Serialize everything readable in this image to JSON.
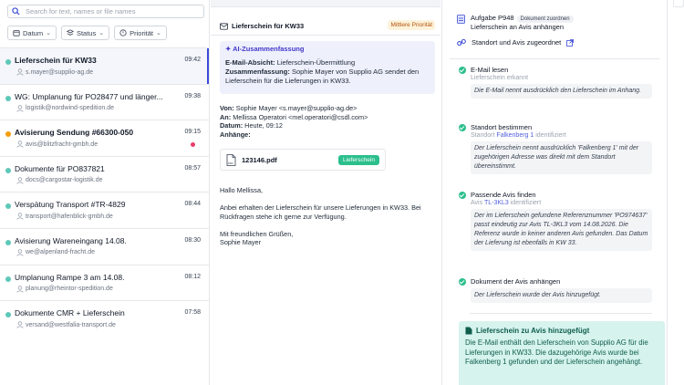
{
  "search": {
    "placeholder": "Search for text, names or file names"
  },
  "filters": [
    {
      "label": "Datum"
    },
    {
      "label": "Status"
    },
    {
      "label": "Priorität"
    }
  ],
  "emails": [
    {
      "title": "Lieferschein für KW33",
      "email": "s.mayer@supplio-ag.de",
      "time": "09:42",
      "bold": true,
      "active": true,
      "dot": "teal"
    },
    {
      "title": "WG: Umplanung für PO28477 und länger...",
      "email": "logistik@nordwind-spedition.de",
      "time": "09:38",
      "dot": "teal"
    },
    {
      "title": "Avisierung Sendung #66300-050",
      "email": "avis@blitzfracht-gmbh.de",
      "time": "09:15",
      "bold": true,
      "dot": "orange",
      "unread": true
    },
    {
      "title": "Dokumente für PO837821",
      "email": "docs@cargostar-logistik.de",
      "time": "08:57",
      "dot": "teal"
    },
    {
      "title": "Verspätung Transport #TR-4829",
      "email": "transport@hafenblick-gmbh.de",
      "time": "08:44",
      "dot": "teal"
    },
    {
      "title": "Avisierung Wareneingang 14.08.",
      "email": "we@alpenland-fracht.de",
      "time": "08:30",
      "dot": "teal"
    },
    {
      "title": "Umplanung Rampe 3 am 14.08.",
      "email": "planung@rheintor-spedition.de",
      "time": "08:12",
      "dot": "teal"
    },
    {
      "title": "Dokumente CMR + Lieferschein",
      "email": "versand@westfalia-transport.de",
      "time": "07:58",
      "dot": "teal"
    }
  ],
  "detail": {
    "subject": "Lieferschein für KW33",
    "priority": "Mittlere Priorität",
    "ai": {
      "heading": "AI-Zusammenfassung",
      "intent_label": "E-Mail-Absicht:",
      "intent": "Lieferschein-Übermittlung",
      "summary_label": "Zusammenfassung:",
      "summary": "Sophie Mayer von Supplio AG sendet den Lieferschein für die Lieferungen in KW33."
    },
    "from_label": "Von:",
    "from": "Sophie Mayer <s.mayer@supplio-ag.de>",
    "to_label": "An:",
    "to": "Mellissa Operatori <mel.operatori@csdl.com>",
    "date_label": "Datum:",
    "date": "Heute, 09:12",
    "attachments_label": "Anhänge:",
    "attachment": {
      "filename": "123146.pdf",
      "tag": "Lieferschein"
    },
    "greeting": "Hallo Mellissa,",
    "body": "Anbei erhalten der Lieferschein für unsere Lieferungen in KW33. Bei Rückfragen stehe ich gerne zur Verfügung.",
    "closing": "Mit freundlichen Grüßen,",
    "signature": "Sophie Mayer"
  },
  "task": {
    "title": "Aufgabe P948",
    "pill": "Dokument zuordnen",
    "subtitle": "Lieferschein an Avis anhängen",
    "link": "Standort und Avis zugeordnet"
  },
  "steps": [
    {
      "title": "E-Mail lesen",
      "sub": "Lieferschein erkannt",
      "quote": "Die E-Mail nennt ausdrücklich den Lieferschein im Anhang."
    },
    {
      "title": "Standort bestimmen",
      "sub_pre": "Standort",
      "sub_link": "Falkenberg 1",
      "sub_post": "identifiziert",
      "quote": "Der Lieferschein nennt ausdrücklich 'Falkenberg 1' mit der zugehörigen Adresse was direkt mit dem Standort übereinstimmt."
    },
    {
      "title": "Passende Avis finden",
      "sub_pre": "Avis",
      "sub_link": "TL-3KL3",
      "sub_post": "identifiziert",
      "quote": "Der im Lieferschein gefundene Referenznummer 'PO974637' passt eindeutig zur Avis TL-3KL3 vom 14.08.2026. Die Referenz wurde in keiner anderen Avis gefunden. Das Datum der Lieferung ist ebenfalls in KW 33."
    },
    {
      "title": "Dokument der Avis anhängen",
      "quote": "Der Lieferschein wurde der Avis hinzugefügt."
    }
  ],
  "success": {
    "title": "Lieferschein zu Avis hinzugefügt",
    "text": "Die E-Mail enthält den Lieferschein von Supplio AG für die Lieferungen in KW33. Die dazugehörige Avis wurde bei Falkenberg 1 gefunden und der Lieferschein angehängt."
  },
  "colors": {
    "accent": "#3b4bd8",
    "teal_dot": "#5ec8b8",
    "orange_dot": "#f59e0b",
    "unread": "#e83e6a",
    "success_bg": "#d6f3ee",
    "check": "#2bbf8c"
  },
  "icons": {
    "search": "search-icon",
    "calendar": "calendar-icon",
    "status": "status-icon",
    "priority": "priority-icon",
    "person": "person-icon",
    "mail": "mail-icon",
    "sparkle": "sparkle-icon",
    "pdf": "pdf-icon",
    "task": "task-icon",
    "link": "link-icon",
    "external": "external-link-icon",
    "check": "check-icon",
    "document": "document-icon"
  }
}
